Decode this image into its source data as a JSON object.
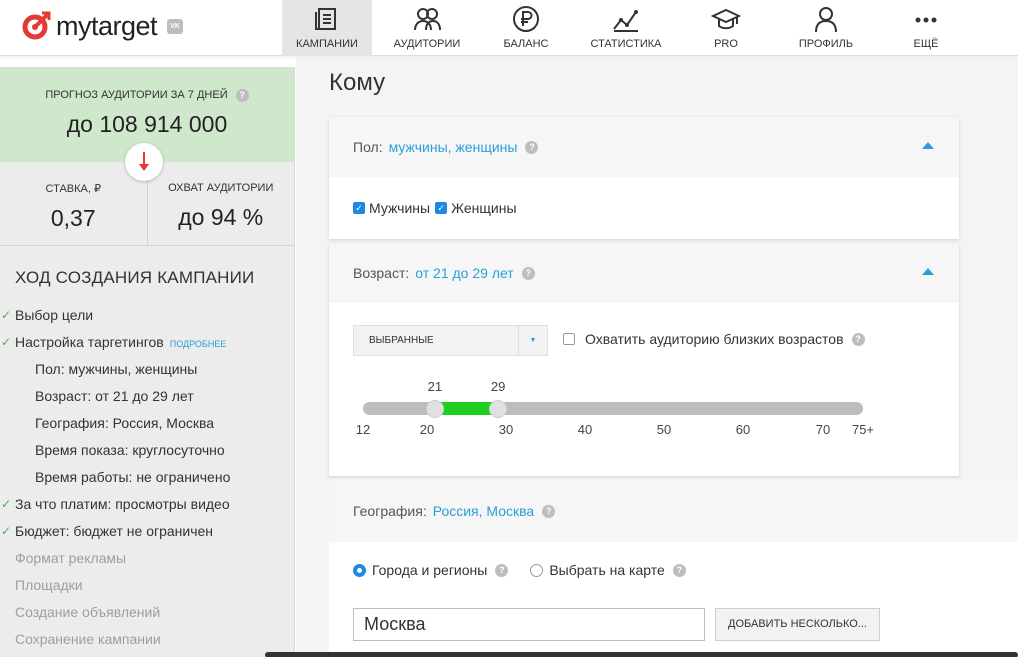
{
  "brand": {
    "name": "mytarget",
    "badge": "VK"
  },
  "nav": [
    {
      "label": "КАМПАНИИ",
      "icon": "campaigns-icon",
      "active": true
    },
    {
      "label": "АУДИТОРИИ",
      "icon": "audiences-icon",
      "active": false
    },
    {
      "label": "БАЛАНС",
      "icon": "ruble-icon",
      "active": false
    },
    {
      "label": "СТАТИСТИКА",
      "icon": "chart-icon",
      "active": false
    },
    {
      "label": "PRO",
      "icon": "graduation-cap-icon",
      "active": false
    },
    {
      "label": "ПРОФИЛЬ",
      "icon": "profile-icon",
      "active": false
    },
    {
      "label": "ЕЩЁ",
      "icon": "more-icon",
      "active": false
    }
  ],
  "sidebar": {
    "forecast_label": "ПРОГНОЗ АУДИТОРИИ ЗА 7 ДНЕЙ",
    "forecast_value": "до 108 914 000",
    "stats": [
      {
        "label": "СТАВКА, ₽",
        "value": "0,37"
      },
      {
        "label": "ОХВАТ АУДИТОРИИ",
        "value": "до 94 %"
      }
    ],
    "progress_title": "ХОД СОЗДАНИЯ КАМПАНИИ",
    "more_link": "ПОДРОБНЕЕ",
    "steps": [
      {
        "label": "Выбор цели",
        "state": "done"
      },
      {
        "label": "Настройка таргетингов",
        "state": "done"
      },
      {
        "label": "Пол: мужчины, женщины",
        "state": "sub"
      },
      {
        "label": "Возраст: от 21 до 29 лет",
        "state": "sub"
      },
      {
        "label": "География: Россия, Москва",
        "state": "sub"
      },
      {
        "label": "Время показа: круглосуточно",
        "state": "sub"
      },
      {
        "label": "Время работы: не ограничено",
        "state": "sub"
      },
      {
        "label": "За что платим: просмотры видео",
        "state": "done"
      },
      {
        "label": "Бюджет: бюджет не ограничен",
        "state": "done"
      },
      {
        "label": "Формат рекламы",
        "state": "pending"
      },
      {
        "label": "Площадки",
        "state": "pending"
      },
      {
        "label": "Создание объявлений",
        "state": "pending"
      },
      {
        "label": "Сохранение кампании",
        "state": "pending"
      }
    ]
  },
  "main": {
    "title": "Кому",
    "gender": {
      "label": "Пол:",
      "value": "мужчины, женщины",
      "options": [
        {
          "label": "Мужчины",
          "checked": true
        },
        {
          "label": "Женщины",
          "checked": true
        }
      ]
    },
    "age": {
      "label": "Возраст:",
      "value": "от 21 до 29 лет",
      "select_value": "ВЫБРАННЫЕ",
      "nearby_label": "Охватить аудиторию близких возрастов",
      "nearby_checked": false,
      "range_min": 21,
      "range_max": 29,
      "ticks": [
        "12",
        "20",
        "30",
        "40",
        "50",
        "60",
        "70",
        "75+"
      ]
    },
    "geo": {
      "label": "География:",
      "value": "Россия, Москва",
      "radio_cities": "Города и регионы",
      "radio_map": "Выбрать на карте",
      "city_value": "Москва",
      "add_button": "ДОБАВИТЬ НЕСКОЛЬКО..."
    }
  },
  "colors": {
    "accent": "#2aa0d8",
    "forecast_bg": "#cfe7cb",
    "slider_fill": "#1fcf1f",
    "brand_red": "#e53935"
  }
}
